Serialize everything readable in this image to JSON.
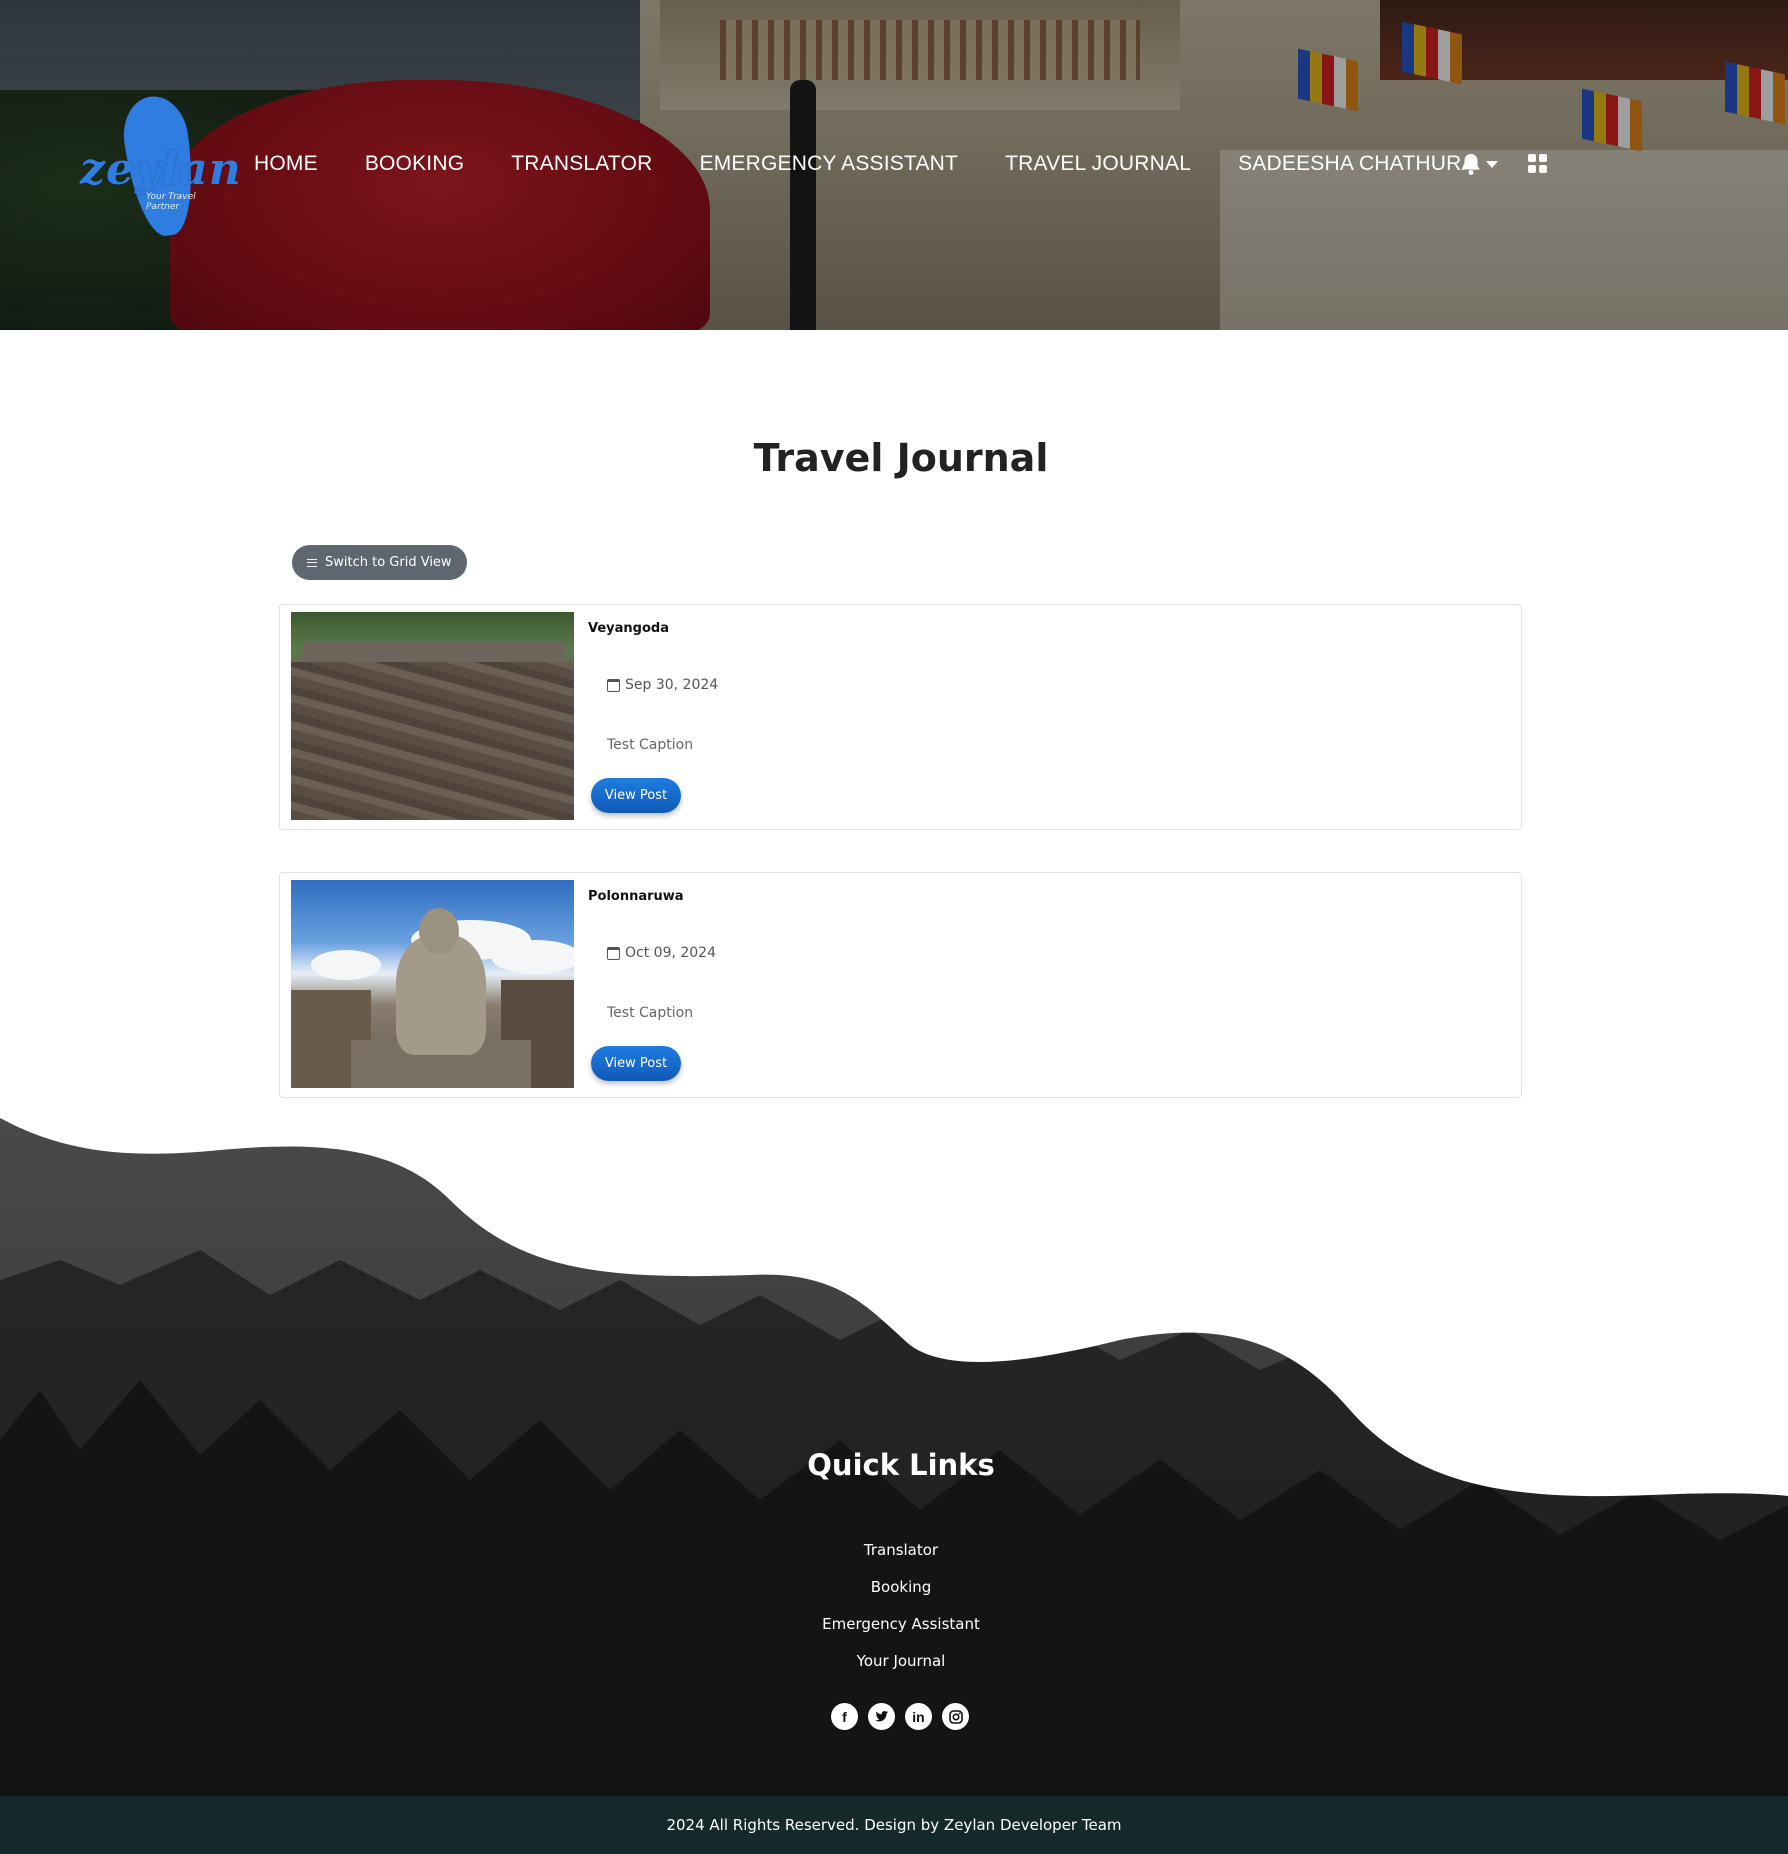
{
  "brand": {
    "name": "zeylan",
    "tagline": "Your Travel Partner",
    "accent": "#2f7de1"
  },
  "nav": {
    "items": [
      "HOME",
      "BOOKING",
      "TRANSLATOR",
      "EMERGENCY ASSISTANT",
      "TRAVEL JOURNAL"
    ],
    "user": "SADEESHA CHATHURA",
    "icons": [
      "bell-icon",
      "grid-icon"
    ]
  },
  "main": {
    "title": "Travel Journal",
    "switch_label": "Switch to Grid View",
    "posts": [
      {
        "place": "Veyangoda",
        "date": "Sep 30, 2024",
        "caption": "Test Caption",
        "button": "View Post"
      },
      {
        "place": "Polonnaruwa",
        "date": "Oct 09, 2024",
        "caption": "Test Caption",
        "button": "View Post"
      }
    ]
  },
  "footer": {
    "title": "Quick Links",
    "links": [
      "Translator",
      "Booking",
      "Emergency Assistant",
      "Your Journal"
    ],
    "social": [
      "facebook-icon",
      "twitter-icon",
      "linkedin-icon",
      "instagram-icon"
    ],
    "copyright": "2024 All Rights Reserved. Design by Zeylan Developer Team"
  }
}
